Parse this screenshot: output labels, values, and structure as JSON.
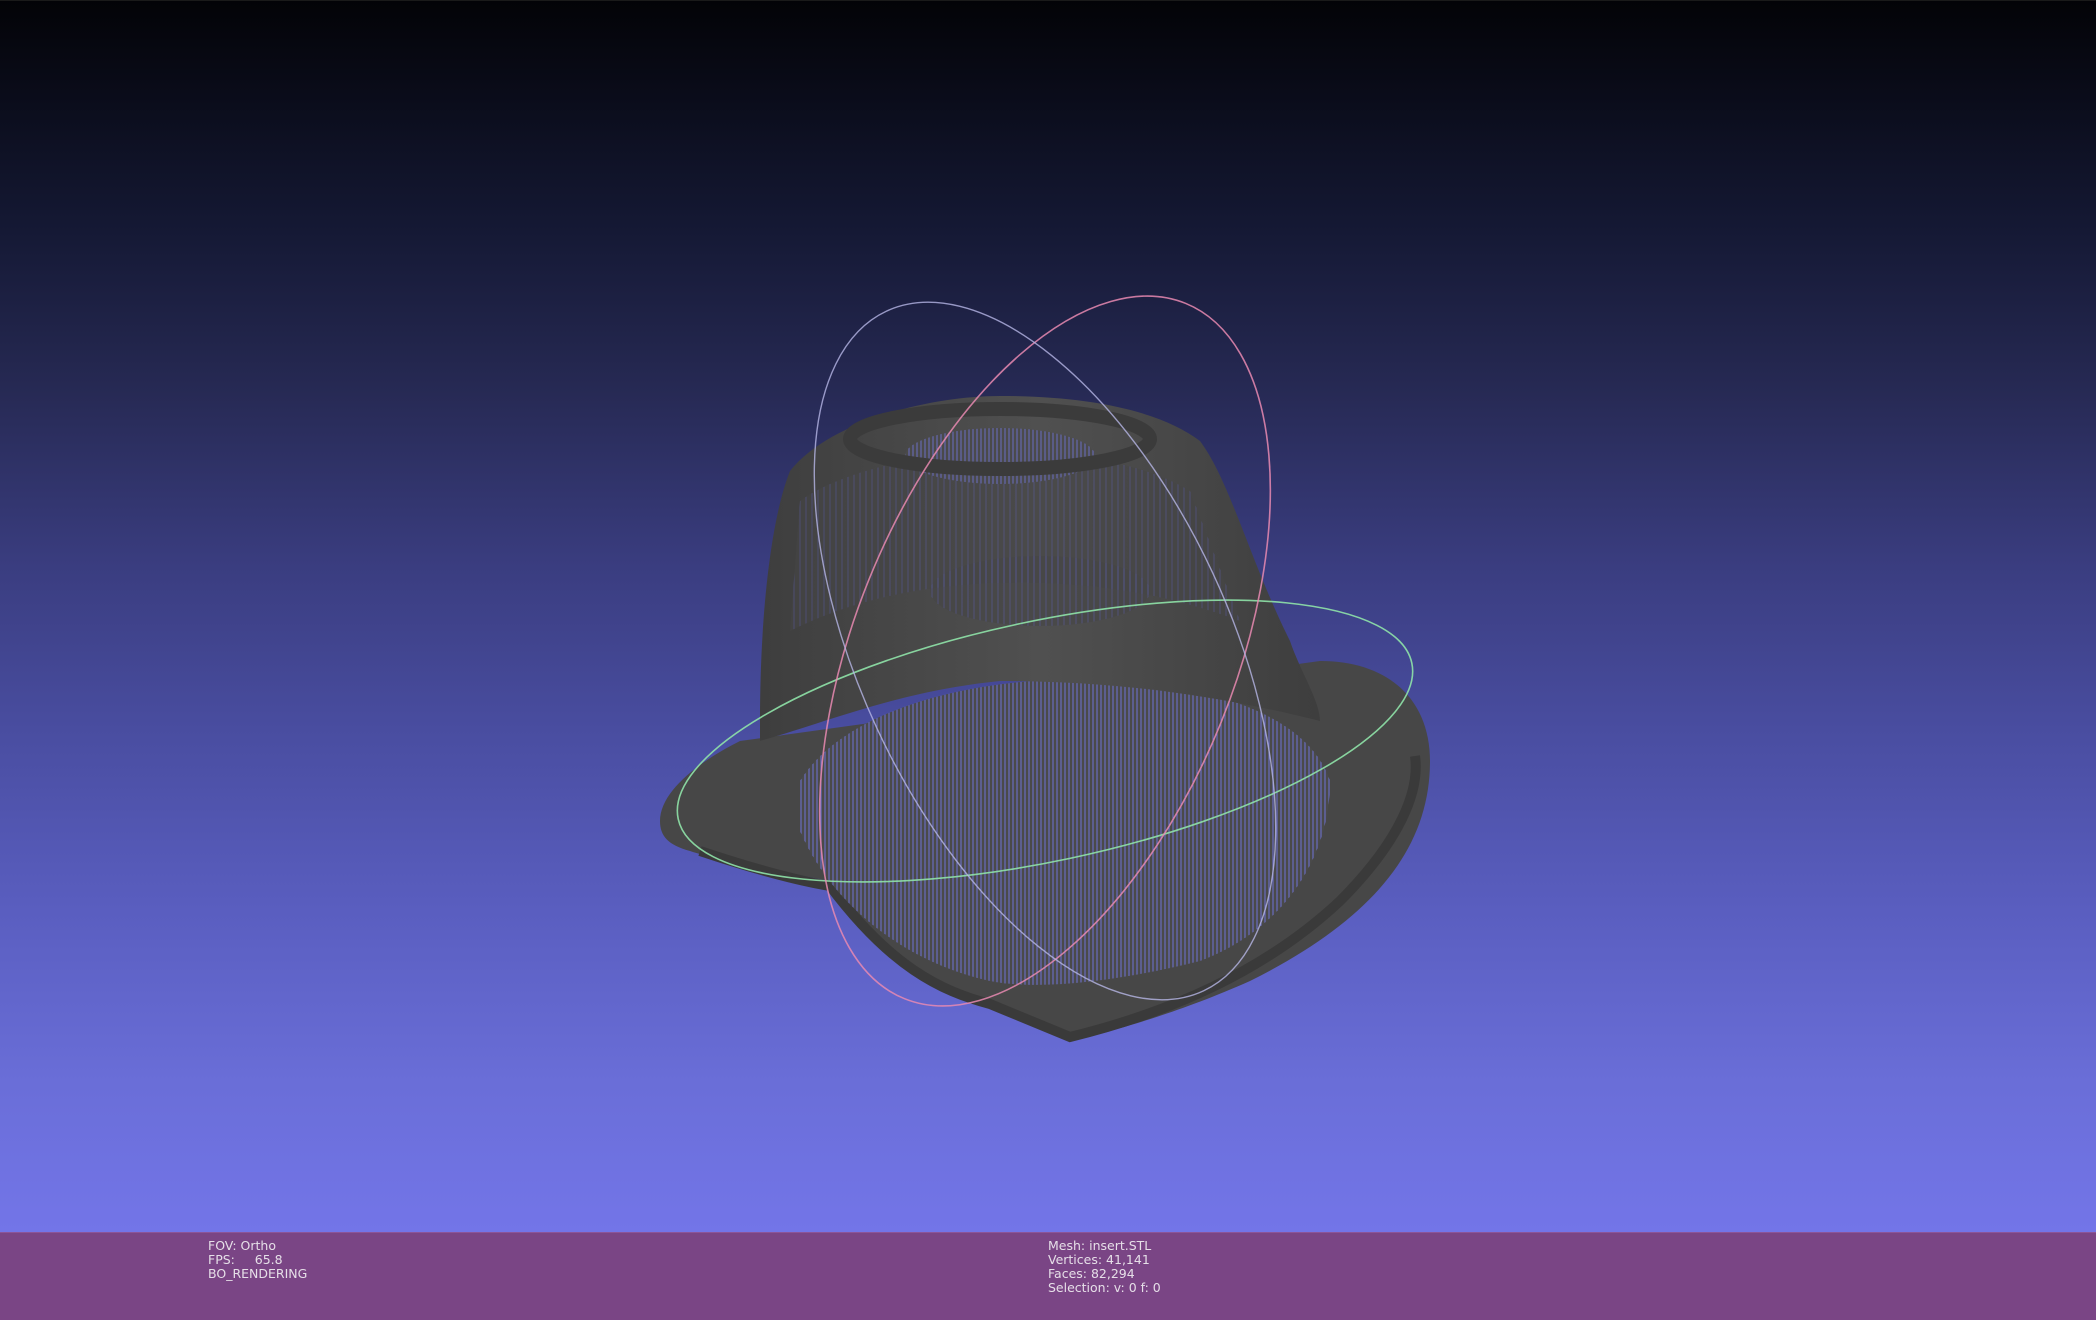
{
  "viewport": {
    "model_description": "wireframe-mesh",
    "trackball_colors": {
      "ring_x": "#e98ab1",
      "ring_y": "#b6b6e6",
      "ring_z": "#8fe3a8"
    },
    "mesh_color": "#4a4a4a",
    "background_top": "#030307",
    "background_bottom": "#7375e8"
  },
  "status": {
    "fov": "FOV: Ortho",
    "fps": "FPS:     65.8",
    "render_mode": "BO_RENDERING",
    "mesh": "Mesh: insert.STL",
    "vertices": "Vertices: 41,141",
    "faces": "Faces: 82,294",
    "selection": "Selection: v: 0 f: 0"
  }
}
